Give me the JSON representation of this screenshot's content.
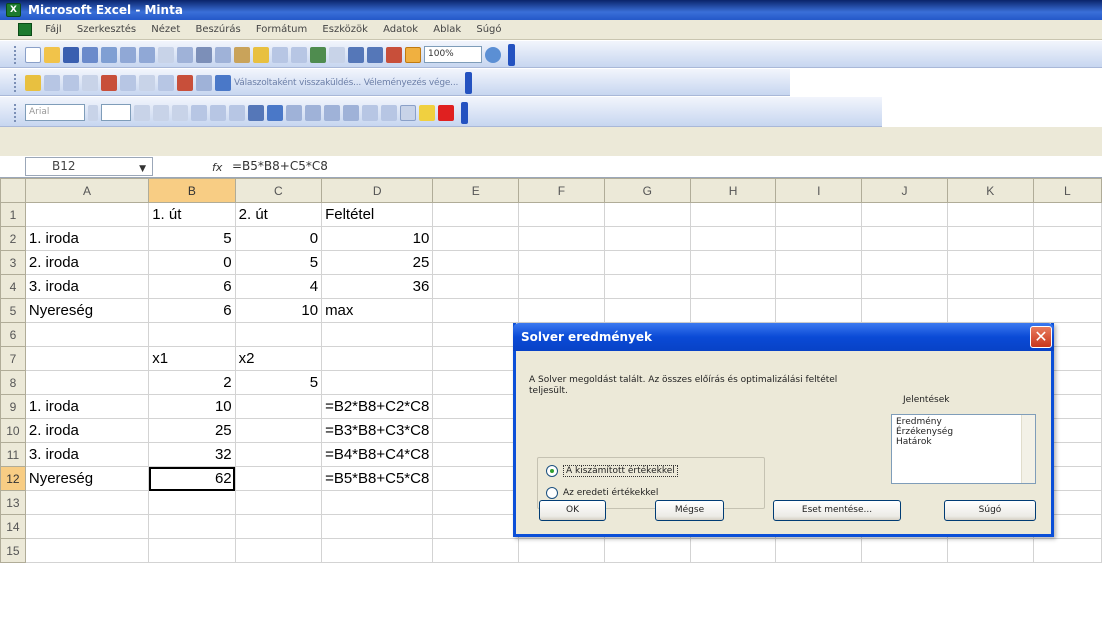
{
  "window": {
    "title": "Microsoft Excel - Minta"
  },
  "menu": [
    "Fájl",
    "Szerkesztés",
    "Nézet",
    "Beszúrás",
    "Formátum",
    "Eszközök",
    "Adatok",
    "Ablak",
    "Súgó"
  ],
  "toolbar": {
    "zoom": "100%",
    "reviewing_text": "Válaszoltaként visszaküldés... Véleményezés vége...",
    "font_name": "Arial"
  },
  "formula_bar": {
    "name_box": "B12",
    "fx": "fx",
    "formula": "=B5*B8+C5*C8"
  },
  "sheet": {
    "columns": [
      "A",
      "B",
      "C",
      "D",
      "E",
      "F",
      "G",
      "H",
      "I",
      "J",
      "K",
      "L"
    ],
    "selected_column": "B",
    "selected_row": "12",
    "rows": [
      {
        "n": "1",
        "cells": [
          "",
          "1. út",
          "2. út",
          "Feltétel",
          "",
          "",
          "",
          "",
          "",
          "",
          "",
          ""
        ]
      },
      {
        "n": "2",
        "cells": [
          "1. iroda",
          "5",
          "0",
          "10",
          "",
          "",
          "",
          "",
          "",
          "",
          "",
          ""
        ]
      },
      {
        "n": "3",
        "cells": [
          "2. iroda",
          "0",
          "5",
          "25",
          "",
          "",
          "",
          "",
          "",
          "",
          "",
          ""
        ]
      },
      {
        "n": "4",
        "cells": [
          "3. iroda",
          "6",
          "4",
          "36",
          "",
          "",
          "",
          "",
          "",
          "",
          "",
          ""
        ]
      },
      {
        "n": "5",
        "cells": [
          "Nyereség",
          "6",
          "10",
          "max",
          "",
          "",
          "",
          "",
          "",
          "",
          "",
          ""
        ]
      },
      {
        "n": "6",
        "cells": [
          "",
          "",
          "",
          "",
          "",
          "",
          "",
          "",
          "",
          "",
          "",
          ""
        ]
      },
      {
        "n": "7",
        "cells": [
          "",
          "x1",
          "x2",
          "",
          "",
          "",
          "",
          "",
          "",
          "",
          "",
          ""
        ]
      },
      {
        "n": "8",
        "cells": [
          "",
          "2",
          "5",
          "",
          "",
          "",
          "",
          "",
          "",
          "",
          "",
          ""
        ]
      },
      {
        "n": "9",
        "cells": [
          "1. iroda",
          "10",
          "",
          "=B2*B8+C2*C8",
          "",
          "",
          "",
          "",
          "",
          "",
          "",
          ""
        ]
      },
      {
        "n": "10",
        "cells": [
          "2. iroda",
          "25",
          "",
          "=B3*B8+C3*C8",
          "",
          "",
          "",
          "",
          "",
          "",
          "",
          ""
        ]
      },
      {
        "n": "11",
        "cells": [
          "3. iroda",
          "32",
          "",
          "=B4*B8+C4*C8",
          "",
          "",
          "",
          "",
          "",
          "",
          "",
          ""
        ]
      },
      {
        "n": "12",
        "cells": [
          "Nyereség",
          "62",
          "",
          "=B5*B8+C5*C8",
          "",
          "",
          "",
          "",
          "",
          "",
          "",
          ""
        ]
      },
      {
        "n": "13",
        "cells": [
          "",
          "",
          "",
          "",
          "",
          "",
          "",
          "",
          "",
          "",
          "",
          ""
        ]
      },
      {
        "n": "14",
        "cells": [
          "",
          "",
          "",
          "",
          "",
          "",
          "",
          "",
          "",
          "",
          "",
          ""
        ]
      },
      {
        "n": "15",
        "cells": [
          "",
          "",
          "",
          "",
          "",
          "",
          "",
          "",
          "",
          "",
          "",
          ""
        ]
      }
    ]
  },
  "dialog": {
    "title": "Solver eredmények",
    "message": "A Solver megoldást talált. Az összes előírás és optimalizálási feltétel teljesült.",
    "options": [
      "A kiszámított értékekkel",
      "Az eredeti értékekkel"
    ],
    "reports_label": "Jelentések",
    "reports": [
      "Eredmény",
      "Érzékenység",
      "Határok"
    ],
    "buttons": {
      "ok": "OK",
      "cancel": "Mégse",
      "save": "Eset mentése...",
      "help": "Súgó"
    }
  }
}
